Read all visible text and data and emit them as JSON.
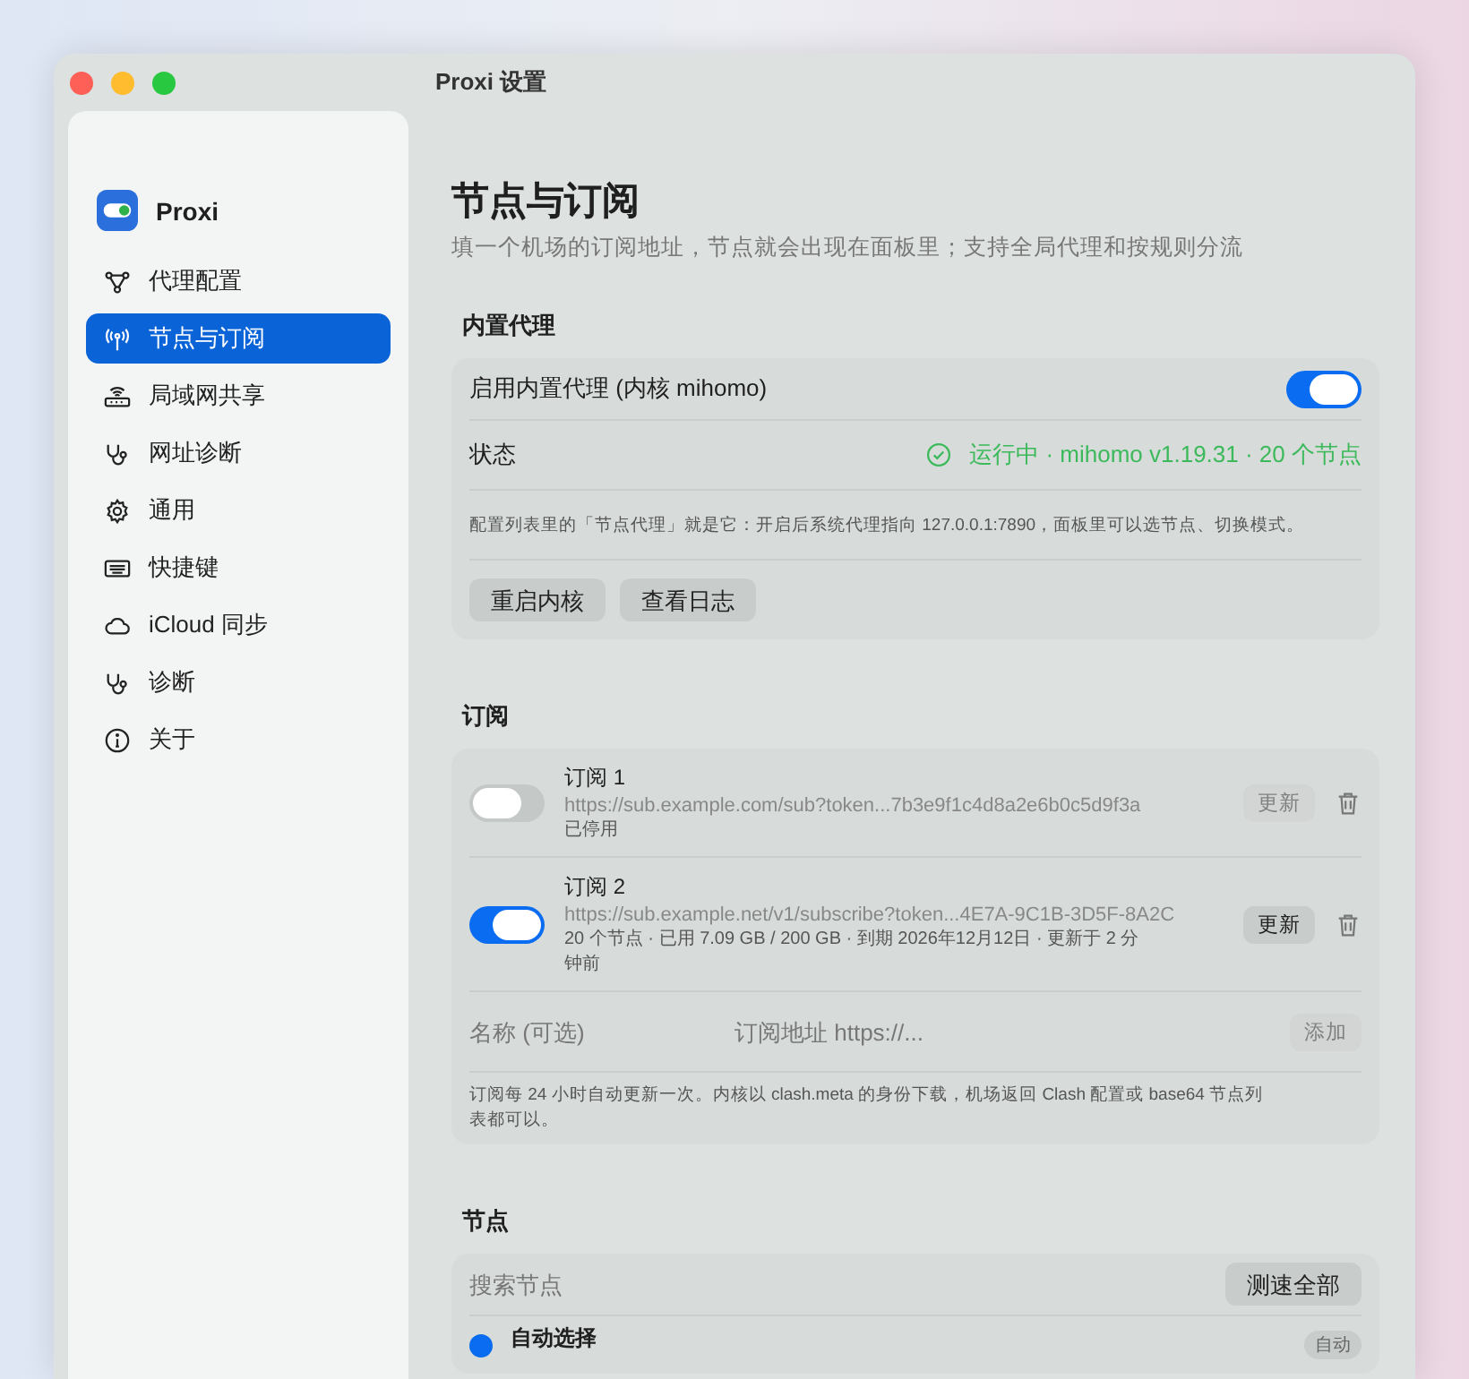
{
  "window": {
    "title": "Proxi 设置"
  },
  "sidebar": {
    "app_name": "Proxi",
    "items": [
      {
        "label": "代理配置",
        "kind": "proxy",
        "selected": false
      },
      {
        "label": "节点与订阅",
        "kind": "antenna",
        "selected": true
      },
      {
        "label": "局域网共享",
        "kind": "router",
        "selected": false
      },
      {
        "label": "网址诊断",
        "kind": "stethoscope",
        "selected": false
      },
      {
        "label": "通用",
        "kind": "gear",
        "selected": false
      },
      {
        "label": "快捷键",
        "kind": "keyboard",
        "selected": false
      },
      {
        "label": "iCloud 同步",
        "kind": "cloud",
        "selected": false
      },
      {
        "label": "诊断",
        "kind": "stethoscope",
        "selected": false
      },
      {
        "label": "关于",
        "kind": "info",
        "selected": false
      }
    ]
  },
  "page": {
    "title": "节点与订阅",
    "subtitle": "填一个机场的订阅地址，节点就会出现在面板里；支持全局代理和按规则分流"
  },
  "builtin_proxy": {
    "heading": "内置代理",
    "enable_label": "启用内置代理 (内核 mihomo)",
    "enabled": true,
    "status_label": "状态",
    "status_value": "运行中 · mihomo v1.19.31 · 20 个节点",
    "note": "配置列表里的「节点代理」就是它：开启后系统代理指向 127.0.0.1:7890，面板里可以选节点、切换模式。",
    "buttons": [
      "重启内核",
      "查看日志"
    ]
  },
  "subscriptions": {
    "heading": "订阅",
    "items": [
      {
        "name": "订阅 1",
        "url": "https://sub.example.com/sub?token...7b3e9f1c4d8a2e6b0c5d9f3a",
        "info": "已停用",
        "enabled": false,
        "update_label": "更新",
        "update_disabled": true
      },
      {
        "name": "订阅 2",
        "url": "https://sub.example.net/v1/subscribe?token...4E7A-9C1B-3D5F-8A2C",
        "info": "20 个节点 · 已用 7.09 GB / 200 GB · 到期 2026年12月12日 · 更新于 2 分钟前",
        "enabled": true,
        "update_label": "更新",
        "update_disabled": false
      }
    ],
    "name_placeholder": "名称 (可选)",
    "url_placeholder": "订阅地址 https://...",
    "add_label": "添加",
    "add_disabled": true,
    "note": "订阅每 24 小时自动更新一次。内核以 clash.meta 的身份下载，机场返回 Clash 配置或 base64 节点列表都可以。"
  },
  "nodes": {
    "heading": "节点",
    "search_placeholder": "搜索节点",
    "test_all_label": "测速全部",
    "items": [
      {
        "name": "自动选择",
        "selected": true,
        "badge": "自动"
      }
    ]
  }
}
